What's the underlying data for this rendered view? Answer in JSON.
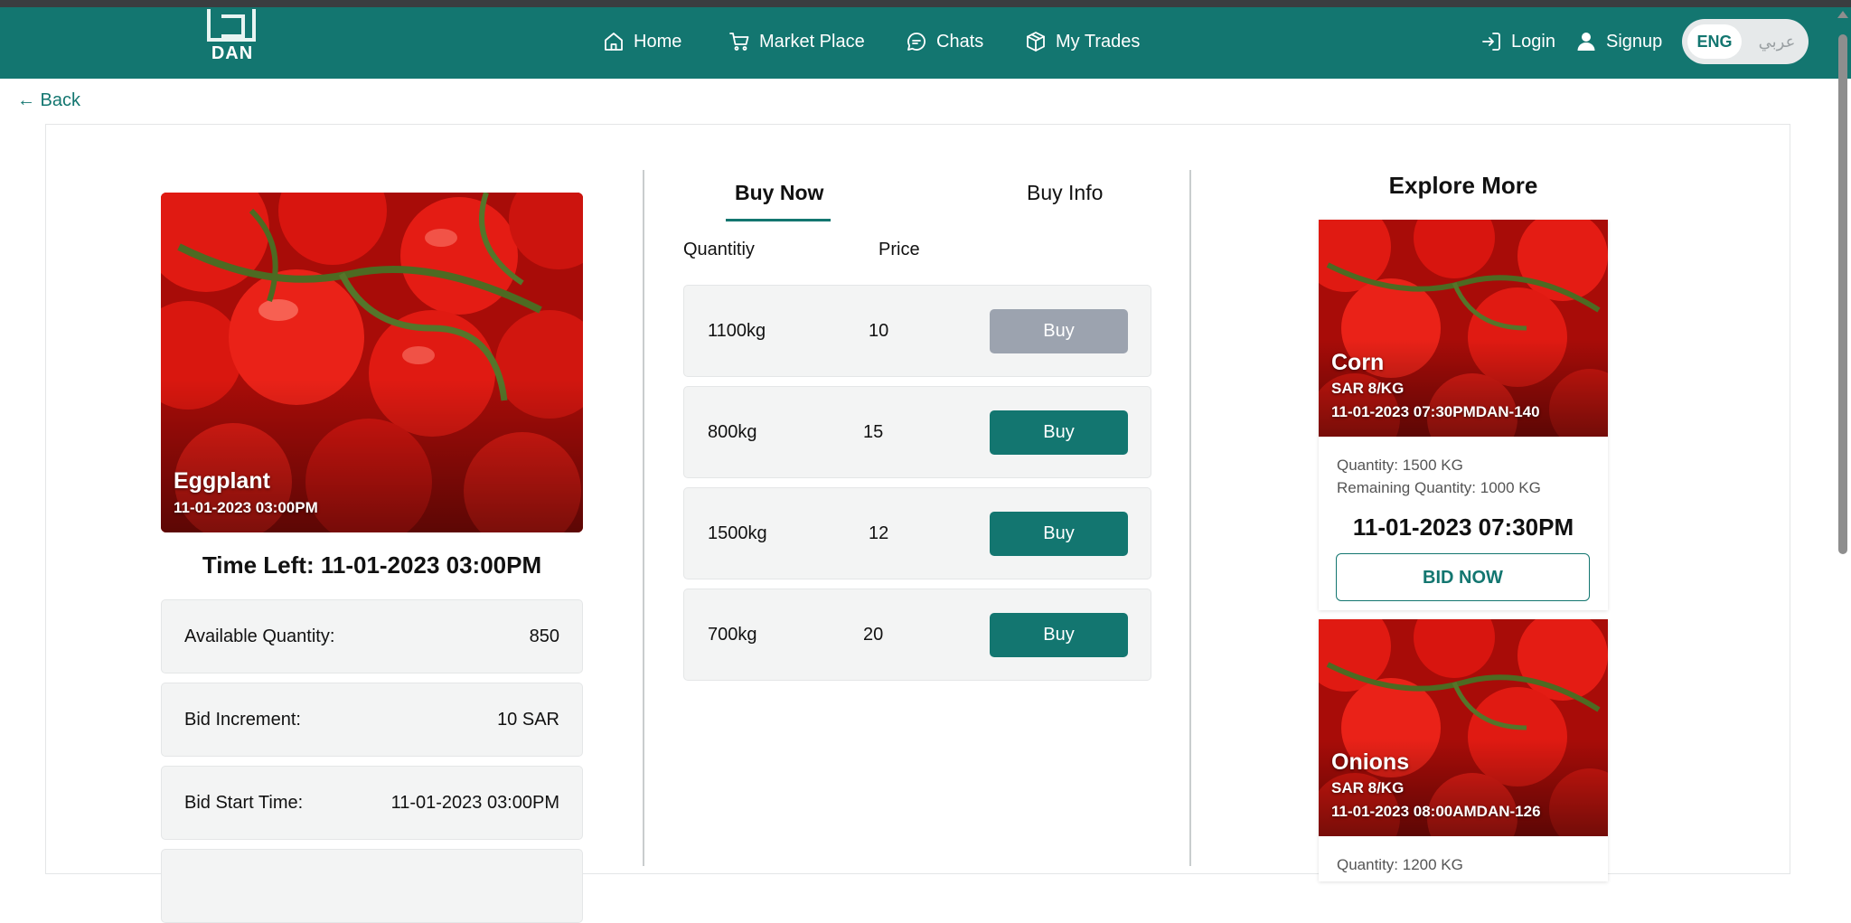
{
  "nav": {
    "logo_text": "DAN",
    "items": [
      {
        "label": "Home",
        "icon": "home-icon"
      },
      {
        "label": "Market Place",
        "icon": "cart-icon"
      },
      {
        "label": "Chats",
        "icon": "chat-icon"
      },
      {
        "label": "My Trades",
        "icon": "package-icon"
      }
    ],
    "login_label": "Login",
    "signup_label": "Signup",
    "lang_eng": "ENG",
    "lang_ar": "عربي"
  },
  "back_label": "← Back",
  "product": {
    "name": "Eggplant",
    "date": "11-01-2023 03:00PM",
    "time_left": "Time Left: 11-01-2023 03:00PM",
    "details": [
      {
        "label": "Available Quantity:",
        "value": "850"
      },
      {
        "label": "Bid Increment:",
        "value": "10 SAR"
      },
      {
        "label": "Bid Start Time:",
        "value": "11-01-2023 03:00PM"
      }
    ]
  },
  "tabs": {
    "buy_now": "Buy Now",
    "buy_info": "Buy Info"
  },
  "offers": {
    "col_quantity": "Quantitiy",
    "col_price": "Price",
    "rows": [
      {
        "quantity": "1100kg",
        "price": "10",
        "button": "Buy",
        "disabled": true
      },
      {
        "quantity": "800kg",
        "price": "15",
        "button": "Buy",
        "disabled": false
      },
      {
        "quantity": "1500kg",
        "price": "12",
        "button": "Buy",
        "disabled": false
      },
      {
        "quantity": "700kg",
        "price": "20",
        "button": "Buy",
        "disabled": false
      }
    ]
  },
  "explore": {
    "title": "Explore More",
    "cards": [
      {
        "name": "Corn",
        "price": "SAR 8/KG",
        "meta": "11-01-2023 07:30PMDAN-140",
        "quantity": "Quantity: 1500 KG",
        "remaining": "Remaining Quantity: 1000 KG",
        "date": "11-01-2023 07:30PM",
        "button": "BID NOW"
      },
      {
        "name": "Onions",
        "price": "SAR 8/KG",
        "meta": "11-01-2023 08:00AMDAN-126",
        "quantity": "Quantity: 1200 KG"
      }
    ]
  },
  "colors": {
    "primary": "#137670",
    "disabled_button": "#9ca3af",
    "row_bg": "#f3f4f4"
  }
}
